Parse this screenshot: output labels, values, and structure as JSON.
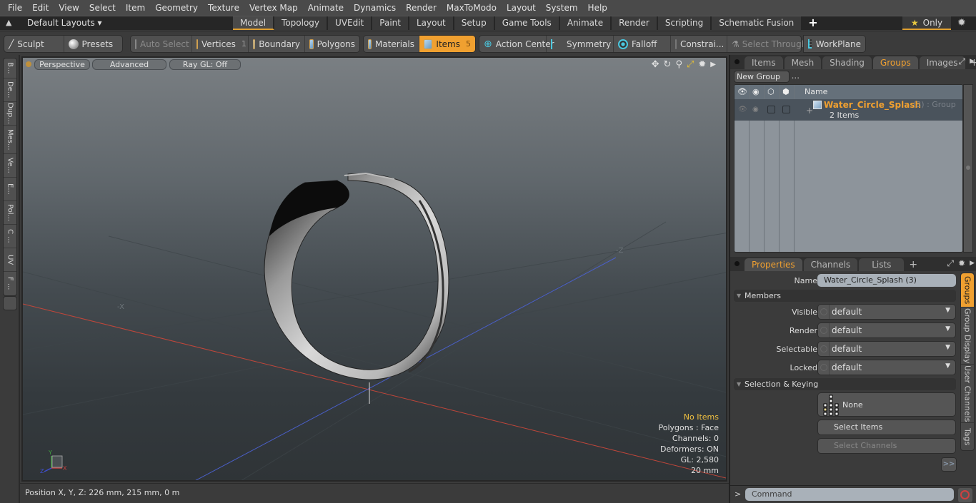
{
  "menu": [
    "File",
    "Edit",
    "View",
    "Select",
    "Item",
    "Geometry",
    "Texture",
    "Vertex Map",
    "Animate",
    "Dynamics",
    "Render",
    "MaxToModo",
    "Layout",
    "System",
    "Help"
  ],
  "layoutbar": {
    "layouts_label": "Default Layouts ▾",
    "tabs": [
      {
        "label": "Model",
        "active": true
      },
      {
        "label": "Topology"
      },
      {
        "label": "UVEdit"
      },
      {
        "label": "Paint"
      },
      {
        "label": "Layout"
      },
      {
        "label": "Setup"
      },
      {
        "label": "Game Tools"
      },
      {
        "label": "Animate"
      },
      {
        "label": "Render"
      },
      {
        "label": "Scripting"
      },
      {
        "label": "Schematic Fusion"
      }
    ],
    "plus": "+",
    "only_label": "Only"
  },
  "toolbar": {
    "sculpt": "Sculpt",
    "presets": "Presets",
    "auto_select": "Auto Select",
    "vertices": "Vertices",
    "vertices_count": "1",
    "boundary": "Boundary",
    "polygons": "Polygons",
    "materials": "Materials",
    "items": "Items",
    "items_count": "5",
    "action_center": "Action Center",
    "symmetry": "Symmetry",
    "falloff": "Falloff",
    "constraints": "Constrai...",
    "select_through": "Select Through",
    "workplane": "WorkPlane"
  },
  "left_tabs": [
    "B...",
    "De...",
    "Dup...",
    "Mes...",
    "Ve...",
    "E...",
    "Pol...",
    "C ...",
    "UV",
    "F ..."
  ],
  "viewport": {
    "view_mode": "Perspective",
    "shading": "Advanced",
    "raygl": "Ray GL: Off",
    "axis_labels": {
      "neg_x": "-X",
      "neg_z": "-Z"
    },
    "gizmo": {
      "y": "Y",
      "x": "X",
      "z": "Z"
    },
    "stats": {
      "selection": "No Items",
      "polygons": "Polygons : Face",
      "channels": "Channels: 0",
      "deformers": "Deformers: ON",
      "gl": "GL: 2,580",
      "grid": "20 mm"
    },
    "colors": {
      "x_axis": "#c0463a",
      "z_axis": "#4a5fc8",
      "warn": "#f0c040"
    }
  },
  "status": {
    "position": "Position X, Y, Z:   226 mm, 215 mm, 0 m"
  },
  "groups_panel": {
    "tabs": [
      {
        "label": "Items"
      },
      {
        "label": "Mesh ..."
      },
      {
        "label": "Shading"
      },
      {
        "label": "Groups",
        "active": true
      },
      {
        "label": "Images"
      }
    ],
    "new_group": "New Group",
    "column_name": "Name",
    "group": {
      "name": "Water_Circle_Splash",
      "meta": "(3) : Group",
      "sub": "2 Items"
    }
  },
  "properties_panel": {
    "tabs": [
      {
        "label": "Properties",
        "active": true
      },
      {
        "label": "Channels"
      },
      {
        "label": "Lists"
      }
    ],
    "name_label": "Name",
    "name_value": "Water_Circle_Splash (3)",
    "members_section": "Members",
    "fields": [
      {
        "label": "Visible",
        "value": "default"
      },
      {
        "label": "Render",
        "value": "default"
      },
      {
        "label": "Selectable",
        "value": "default"
      },
      {
        "label": "Locked",
        "value": "default"
      }
    ],
    "selection_section": "Selection & Keying",
    "none_label": "None",
    "select_items": "Select Items",
    "select_channels": "Select Channels",
    "more": ">>",
    "side_tabs": [
      {
        "label": "Groups",
        "active": true
      },
      {
        "label": "Group Display"
      },
      {
        "label": "User Channels"
      },
      {
        "label": "Tags"
      }
    ]
  },
  "command": {
    "prompt": ">",
    "placeholder": "Command"
  }
}
